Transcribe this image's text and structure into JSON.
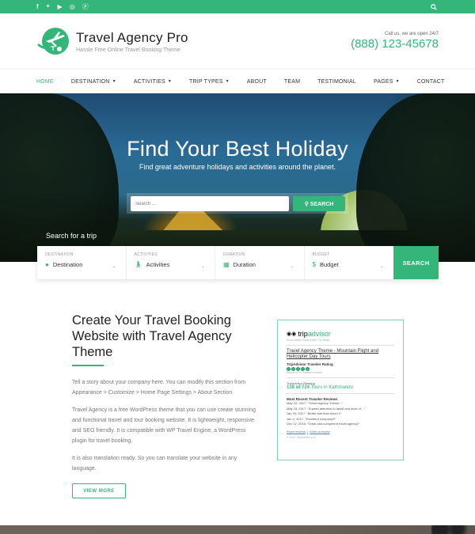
{
  "topbar": {
    "social": [
      {
        "name": "facebook-icon",
        "glyph": "f"
      },
      {
        "name": "twitter-icon",
        "glyph": "🐦"
      },
      {
        "name": "youtube-icon",
        "glyph": "▶"
      },
      {
        "name": "instagram-icon",
        "glyph": "◎"
      },
      {
        "name": "pinterest-icon",
        "glyph": "ⓟ"
      }
    ],
    "search_glyph": "⚲"
  },
  "header": {
    "site_title": "Travel Agency Pro",
    "tagline": "Hassle Free Online Travel Booking Theme",
    "call_text": "Call us, we are open 24/7",
    "phone": "(888) 123-45678"
  },
  "nav": {
    "items": [
      {
        "label": "HOME",
        "active": true,
        "dropdown": false
      },
      {
        "label": "DESTINATION",
        "dropdown": true
      },
      {
        "label": "ACTIVITIES",
        "dropdown": true
      },
      {
        "label": "TRIP TYPES",
        "dropdown": true
      },
      {
        "label": "ABOUT",
        "dropdown": false
      },
      {
        "label": "TEAM",
        "dropdown": false
      },
      {
        "label": "TESTIMONIAL",
        "dropdown": false
      },
      {
        "label": "PAGES",
        "dropdown": true
      },
      {
        "label": "CONTACT",
        "dropdown": false
      }
    ],
    "caret": "▼"
  },
  "hero": {
    "title": "Find Your Best Holiday",
    "subtitle": "Find great adventure holidays and activities around the planet.",
    "search_placeholder": "Search ...",
    "search_button": "⚲ SEARCH",
    "trip_label": "Search for a trip"
  },
  "trip_search": {
    "fields": [
      {
        "label": "DESTINATION",
        "value": "Destination",
        "icon": "map-pin-icon",
        "glyph": "📍"
      },
      {
        "label": "ACTIVITIES",
        "value": "Activities",
        "icon": "hiker-icon",
        "glyph": "🚶"
      },
      {
        "label": "DURATION",
        "value": "Duration",
        "icon": "calendar-icon",
        "glyph": "▦"
      },
      {
        "label": "BUDGET",
        "value": "Budget",
        "icon": "dollar-icon",
        "glyph": "$"
      }
    ],
    "chevron": "⌄",
    "button": "SEARCH"
  },
  "about": {
    "heading": "Create Your Travel Booking Website with Travel Agency Theme",
    "paragraphs": [
      "Tell a story about your company here. You can modify this section from Appearance > Customize > Home Page Settings > About Section.",
      "Travel Agency is a free WordPress theme that you can use create stunning and functional travel and tour booking website. It is lightweight, responsive and SEO friendly. It is compatible with WP Travel Engine, a WordPress plugin for travel booking.",
      "It is also translation ready. So you can translate your website in any language."
    ],
    "button": "VIEW MORE"
  },
  "tripadvisor": {
    "brand_trip": "trip",
    "brand_advisor": "advisor",
    "tagline": "Know better. Book better. Go better.",
    "tour_title": "Travel Agency Theme - Mountain Flight and Helicopter Day Tours",
    "rating_title": "TripAdvisor Traveler Rating",
    "rating_value": 5,
    "rating_max": 5,
    "based_on": "Based on 92 traveler reviews",
    "ranking_title": "TripAdvisor Ranking",
    "ranking_num": "138 of 724",
    "ranking_rest": " Tours in Kathmandu",
    "reviews_title": "Most Recent Traveler Reviews",
    "reviews": [
      "May 20, 2017: “Travel Agency Theme...”",
      "May 18, 2017: “Superb attention to detail and level of...”",
      "Jan 29, 2017: “Better late than never !!”",
      "Jan 4, 2017: “Excellent company!!!”",
      "Dec 12, 2016: “Great and competent travel agency!”"
    ],
    "read_reviews": "Read reviews",
    "separator": "|",
    "write_review": "Write a review",
    "copyright": "© 2017 TripAdvisor LLC"
  },
  "colors": {
    "accent": "#34b57a",
    "text_dark": "#222222",
    "text_muted": "#777777"
  }
}
